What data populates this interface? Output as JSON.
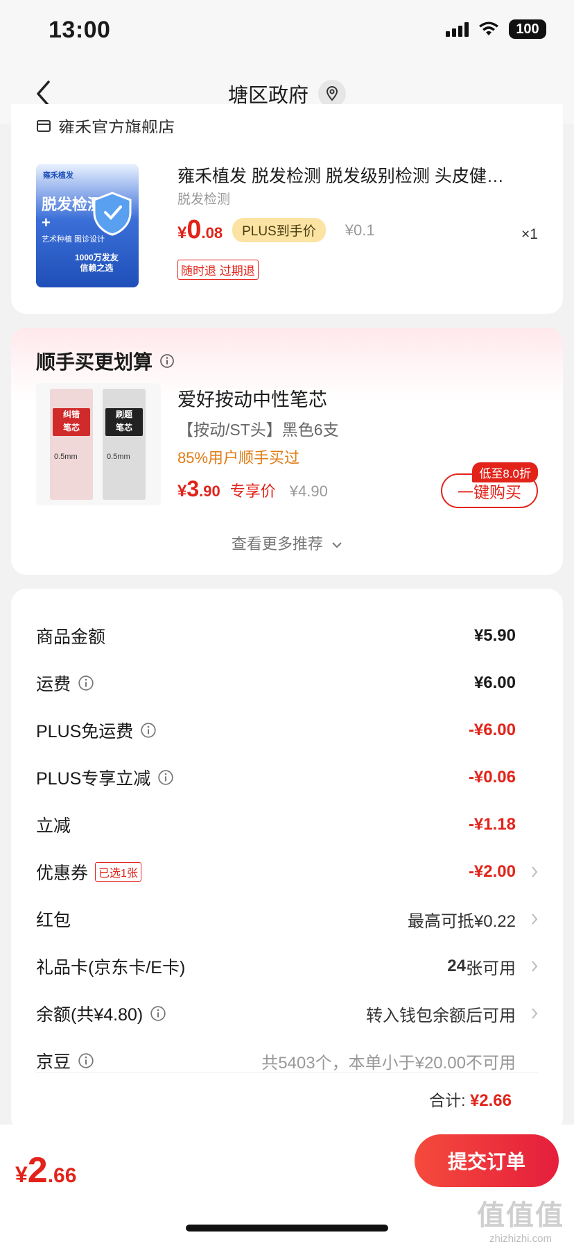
{
  "status_bar": {
    "time": "13:00",
    "battery": "100"
  },
  "header": {
    "title": "塘区政府"
  },
  "shop": {
    "name": "雍禾官方旗舰店",
    "product": {
      "title": "雍禾植发 脱发检测 脱发级别检测 头皮健…",
      "subtitle": "脱发检测",
      "image_text": {
        "brand": "雍禾植发",
        "main": "脱发检测\n+",
        "sub": "艺术种植 图诊设计",
        "badge": "1000万发友\n信赖之选"
      },
      "price_currency": "¥",
      "price_int": "0",
      "price_dec": ".08",
      "plus_tag": "PLUS到手价",
      "original_price": "¥0.1",
      "quantity": "×1",
      "return_tag": "随时退 过期退"
    }
  },
  "recommend": {
    "title": "顺手买更划算",
    "product": {
      "name": "爱好按动中性笔芯",
      "spec": "【按动/ST头】黑色6支",
      "hint": "85%用户顺手买过",
      "price_currency": "¥",
      "price_int": "3",
      "price_dec": ".90",
      "price_tag": "专享价",
      "original_price": "¥4.90",
      "image_text": {
        "red_label": "纠错\n笔芯",
        "black_label": "刷题\n笔芯",
        "size": "0.5mm"
      }
    },
    "buy_badge": "低至8.0折",
    "buy_button": "一键购买",
    "more": "查看更多推荐"
  },
  "summary": {
    "rows": [
      {
        "label": "商品金额",
        "value": "¥5.90"
      },
      {
        "label": "运费",
        "value": "¥6.00"
      },
      {
        "label": "PLUS免运费",
        "value": "-¥6.00"
      },
      {
        "label": "PLUS专享立减",
        "value": "-¥0.06"
      },
      {
        "label": "立减",
        "value": "-¥1.18"
      },
      {
        "label": "优惠券",
        "tag": "已选1张",
        "value": "-¥2.00"
      },
      {
        "label": "红包",
        "value": "最高可抵¥0.22"
      },
      {
        "label": "礼品卡(京东卡/E卡)",
        "value_bold": "24",
        "value_rest": "张可用"
      },
      {
        "label": "余额(共¥4.80)",
        "value": "转入钱包余额后可用"
      },
      {
        "label": "京豆",
        "value": "共5403个，本单小于¥20.00不可用"
      }
    ],
    "total_label": "合计:",
    "total_value": "¥2.66"
  },
  "bottom": {
    "price_currency": "¥",
    "price_int": "2",
    "price_dec": ".66",
    "submit": "提交订单"
  },
  "watermark": {
    "big": "值值值",
    "small": "zhizhizhi.com"
  },
  "colors": {
    "accent_red": "#e2231a",
    "plus_gold": "#fbe4a3",
    "hint_orange": "#e07b14"
  }
}
